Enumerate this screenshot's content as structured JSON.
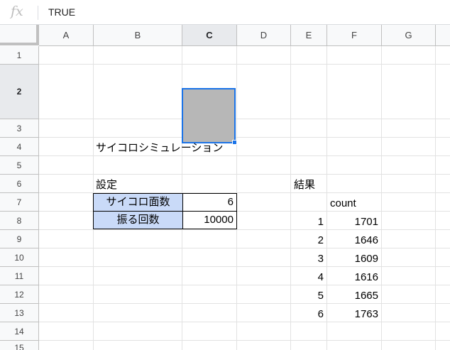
{
  "formula_bar": {
    "fx_label": "fx",
    "value": "TRUE"
  },
  "columns": [
    "A",
    "B",
    "C",
    "D",
    "E",
    "F",
    "G"
  ],
  "rows": [
    "1",
    "2",
    "3",
    "4",
    "5",
    "6",
    "7",
    "8",
    "9",
    "10",
    "11",
    "12",
    "13",
    "14",
    "15"
  ],
  "selected_cell": "C2",
  "checkbox_checked": true,
  "sheet": {
    "title": "サイコロシミュレーション",
    "settings_label": "設定",
    "dice_faces_label": "サイコロ面数",
    "dice_faces_value": "6",
    "rolls_label": "振る回数",
    "rolls_value": "10000",
    "results_label": "結果",
    "count_header": "count",
    "results": [
      {
        "face": "1",
        "count": "1701"
      },
      {
        "face": "2",
        "count": "1646"
      },
      {
        "face": "3",
        "count": "1609"
      },
      {
        "face": "4",
        "count": "1616"
      },
      {
        "face": "5",
        "count": "1665"
      },
      {
        "face": "6",
        "count": "1763"
      }
    ]
  }
}
